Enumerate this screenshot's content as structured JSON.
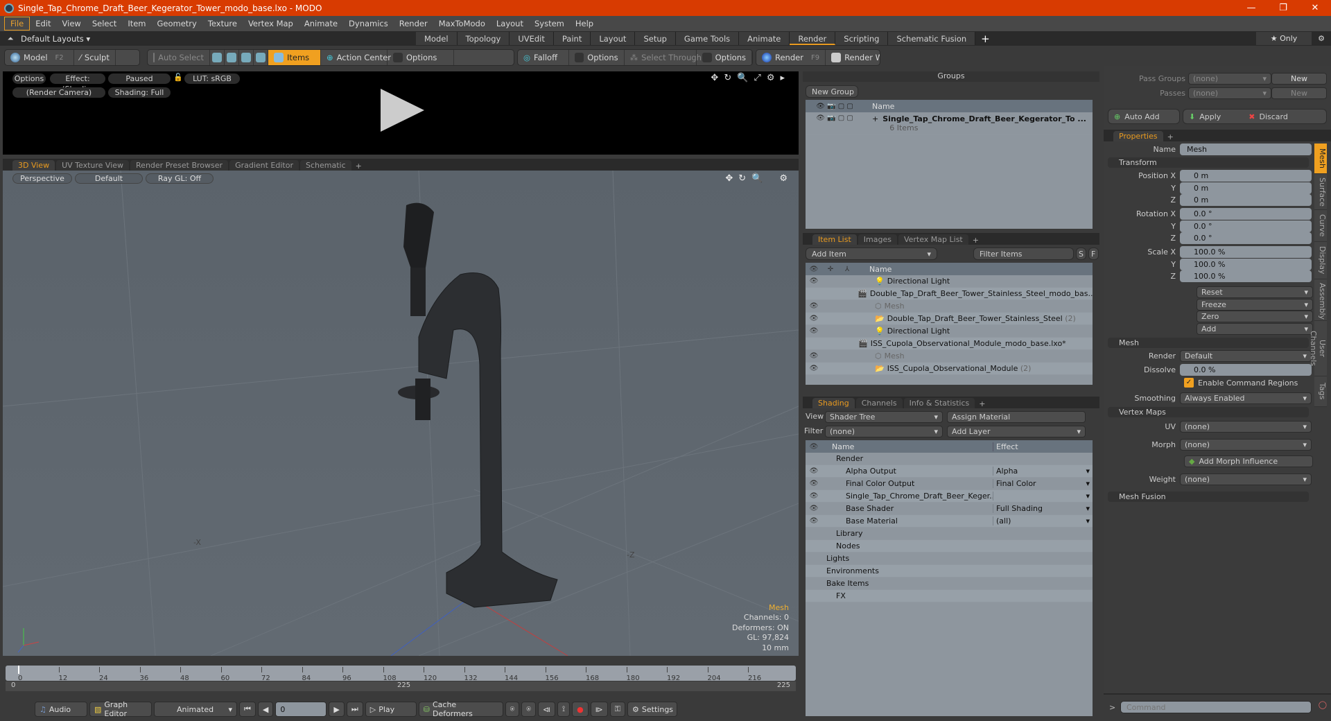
{
  "window": {
    "title": "Single_Tap_Chrome_Draft_Beer_Kegerator_Tower_modo_base.lxo - MODO",
    "controls": [
      "—",
      "❐",
      "✕"
    ]
  },
  "menu": [
    "File",
    "Edit",
    "View",
    "Select",
    "Item",
    "Geometry",
    "Texture",
    "Vertex Map",
    "Animate",
    "Dynamics",
    "Render",
    "MaxToModo",
    "Layout",
    "System",
    "Help"
  ],
  "layouts": {
    "label": "Default Layouts ▾",
    "tabs": [
      "Model",
      "Topology",
      "UVEdit",
      "Paint",
      "Layout",
      "Setup",
      "Game Tools",
      "Animate",
      "Render",
      "Scripting",
      "Schematic Fusion"
    ],
    "active": "Render",
    "only": "★ Only"
  },
  "toolbar": {
    "model": "Model",
    "model_key": "F2",
    "sculpt": "Sculpt",
    "auto_select": "Auto Select",
    "items": "Items",
    "action_center": "Action Center",
    "options": "Options",
    "falloff": "Falloff",
    "select_through": "Select Through",
    "render": "Render",
    "render_key": "F9",
    "render_window": "Render Window"
  },
  "preview": {
    "options": "Options",
    "effect": "Effect: (Shadi...",
    "paused": "Paused",
    "lut": "LUT: sRGB",
    "camera": "(Render Camera)",
    "shading": "Shading: Full"
  },
  "viewport": {
    "tabs": [
      "3D View",
      "UV Texture View",
      "Render Preset Browser",
      "Gradient Editor",
      "Schematic"
    ],
    "active": "3D View",
    "perspective": "Perspective",
    "default": "Default",
    "raygl": "Ray GL: Off",
    "info": {
      "type": "Mesh",
      "channels": "Channels: 0",
      "deformers": "Deformers: ON",
      "gl": "GL: 97,824",
      "unit": "10 mm"
    },
    "axis_x": "-X",
    "axis_z": "-Z"
  },
  "timeline": {
    "ticks": [
      "0",
      "12",
      "24",
      "36",
      "48",
      "60",
      "72",
      "84",
      "96",
      "108",
      "120",
      "132",
      "144",
      "156",
      "168",
      "180",
      "192",
      "204",
      "216"
    ],
    "range_start": "0",
    "range_mid": "225",
    "range_end": "225"
  },
  "transport": {
    "audio": "Audio",
    "graph_editor": "Graph Editor",
    "animated": "Animated",
    "frame": "0",
    "play": "Play",
    "cache": "Cache Deformers",
    "settings": "Settings"
  },
  "groups": {
    "title": "Groups",
    "new_group": "New Group",
    "col_name": "Name",
    "item_name": "Single_Tap_Chrome_Draft_Beer_Kegerator_To ...",
    "item_count": "6 Items"
  },
  "itemlist": {
    "tabs": [
      "Item List",
      "Images",
      "Vertex Map List"
    ],
    "add_item": "Add Item",
    "filter": "Filter Items",
    "col_name": "Name",
    "rows": [
      {
        "name": "Directional Light",
        "indent": 2,
        "eye": true,
        "dim": false
      },
      {
        "name": "Double_Tap_Draft_Beer_Tower_Stainless_Steel_modo_bas...",
        "indent": 0,
        "eye": false,
        "dim": false
      },
      {
        "name": "Mesh",
        "indent": 2,
        "eye": true,
        "dim": true
      },
      {
        "name": "Double_Tap_Draft_Beer_Tower_Stainless_Steel",
        "suffix": " (2)",
        "indent": 2,
        "eye": true,
        "dim": false
      },
      {
        "name": "Directional Light",
        "indent": 2,
        "eye": true,
        "dim": false
      },
      {
        "name": "ISS_Cupola_Observational_Module_modo_base.lxo*",
        "indent": 0,
        "eye": false,
        "dim": false
      },
      {
        "name": "Mesh",
        "indent": 2,
        "eye": true,
        "dim": true
      },
      {
        "name": "ISS_Cupola_Observational_Module",
        "suffix": " (2)",
        "indent": 2,
        "eye": true,
        "dim": false
      }
    ]
  },
  "shading": {
    "tabs": [
      "Shading",
      "Channels",
      "Info & Statistics"
    ],
    "view_label": "View",
    "view": "Shader Tree",
    "assign": "Assign Material",
    "filter_label": "Filter",
    "filter": "(none)",
    "add_layer": "Add Layer",
    "col_name": "Name",
    "col_effect": "Effect",
    "rows": [
      {
        "name": "Render",
        "effect": "",
        "eye": false,
        "indent": 1
      },
      {
        "name": "Alpha Output",
        "effect": "Alpha",
        "eye": true,
        "indent": 2
      },
      {
        "name": "Final Color Output",
        "effect": "Final Color",
        "eye": true,
        "indent": 2
      },
      {
        "name": "Single_Tap_Chrome_Draft_Beer_Keger...",
        "effect": "",
        "eye": true,
        "indent": 2
      },
      {
        "name": "Base Shader",
        "effect": "Full Shading",
        "eye": true,
        "indent": 2
      },
      {
        "name": "Base Material",
        "effect": "(all)",
        "eye": true,
        "indent": 2
      },
      {
        "name": "Library",
        "effect": "",
        "eye": false,
        "indent": 1
      },
      {
        "name": "Nodes",
        "effect": "",
        "eye": false,
        "indent": 1
      },
      {
        "name": "Lights",
        "effect": "",
        "eye": false,
        "indent": 0
      },
      {
        "name": "Environments",
        "effect": "",
        "eye": false,
        "indent": 0
      },
      {
        "name": "Bake Items",
        "effect": "",
        "eye": false,
        "indent": 0
      },
      {
        "name": "FX",
        "effect": "",
        "eye": false,
        "indent": 1
      }
    ]
  },
  "passes": {
    "pass_groups_label": "Pass Groups",
    "pass_groups": "(none)",
    "passes_label": "Passes",
    "passes": "(none)",
    "new": "New",
    "auto_add": "Auto Add",
    "apply": "Apply",
    "discard": "Discard"
  },
  "properties": {
    "tab": "Properties",
    "name_label": "Name",
    "name": "Mesh",
    "transform": "Transform",
    "position": [
      "0 m",
      "0 m",
      "0 m"
    ],
    "rotation": [
      "0.0 °",
      "0.0 °",
      "0.0 °"
    ],
    "scale": [
      "100.0 %",
      "100.0 %",
      "100.0 %"
    ],
    "labels": {
      "px": "Position X",
      "rx": "Rotation X",
      "sx": "Scale X",
      "y": "Y",
      "z": "Z"
    },
    "actions": [
      "Reset",
      "Freeze",
      "Zero",
      "Add"
    ],
    "mesh": "Mesh",
    "render_label": "Render",
    "render": "Default",
    "dissolve_label": "Dissolve",
    "dissolve": "0.0 %",
    "cmd_regions": "Enable Command Regions",
    "smoothing_label": "Smoothing",
    "smoothing": "Always Enabled",
    "vertex_maps": "Vertex Maps",
    "uv_label": "UV",
    "uv": "(none)",
    "morph_label": "Morph",
    "morph": "(none)",
    "add_morph": "Add Morph Influence",
    "weight_label": "Weight",
    "weight": "(none)",
    "mesh_fusion": "Mesh Fusion",
    "side_tabs": [
      "Mesh",
      "Surface",
      "Curve",
      "Display",
      "Assembly",
      "User Channels",
      "Tags"
    ]
  },
  "command": {
    "placeholder": "Command"
  }
}
